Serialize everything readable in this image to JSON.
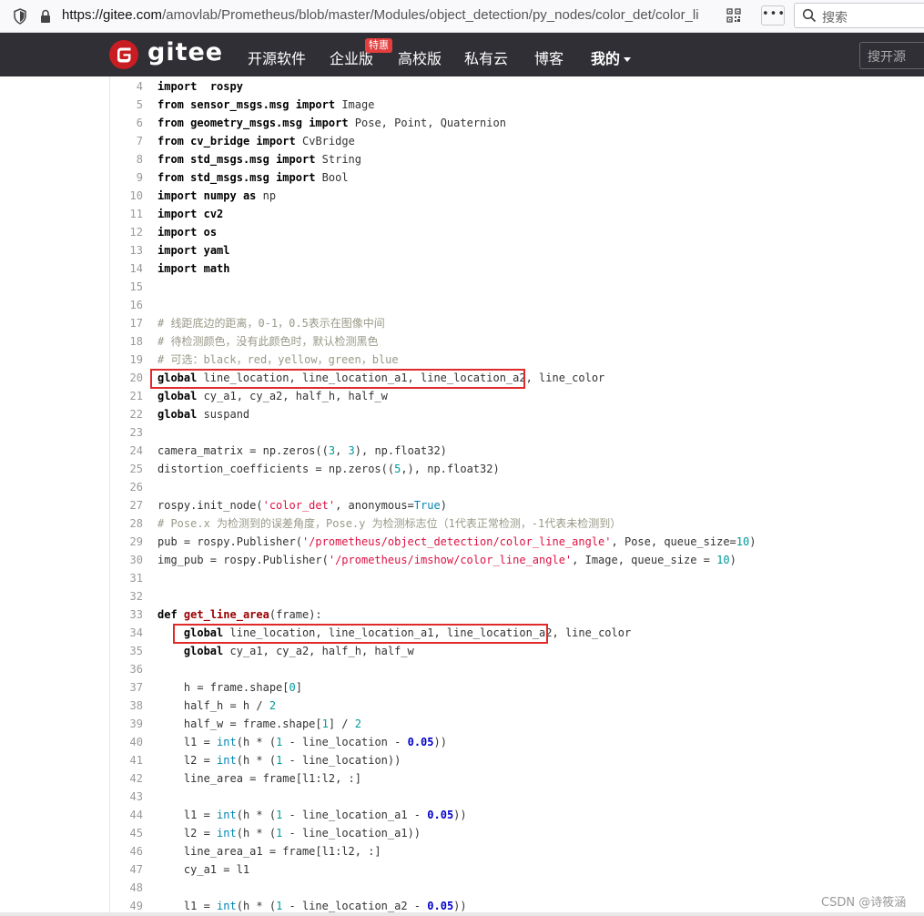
{
  "browser": {
    "url_host": "https://gitee.com",
    "url_path": "/amovlab/Prometheus/blob/master/Modules/object_detection/py_nodes/color_det/color_li",
    "more_label": "•••",
    "search_placeholder": "搜索"
  },
  "nav": {
    "brand": "gitee",
    "items": [
      "开源软件",
      "企业版",
      "高校版",
      "私有云",
      "博客",
      "我的"
    ],
    "badge": "特惠",
    "search_placeholder": "搜开源"
  },
  "code": {
    "lines": [
      {
        "n": "4",
        "tokens": [
          [
            "kw",
            "import"
          ],
          [
            "",
            "  "
          ],
          [
            "mod",
            "rospy"
          ]
        ]
      },
      {
        "n": "5",
        "tokens": [
          [
            "kw",
            "from"
          ],
          [
            "",
            " "
          ],
          [
            "mod",
            "sensor_msgs.msg"
          ],
          [
            "",
            " "
          ],
          [
            "kw",
            "import"
          ],
          [
            "",
            " Image"
          ]
        ]
      },
      {
        "n": "6",
        "tokens": [
          [
            "kw",
            "from"
          ],
          [
            "",
            " "
          ],
          [
            "mod",
            "geometry_msgs.msg"
          ],
          [
            "",
            " "
          ],
          [
            "kw",
            "import"
          ],
          [
            "",
            " Pose, Point, Quaternion"
          ]
        ]
      },
      {
        "n": "7",
        "tokens": [
          [
            "kw",
            "from"
          ],
          [
            "",
            " "
          ],
          [
            "mod",
            "cv_bridge"
          ],
          [
            "",
            " "
          ],
          [
            "kw",
            "import"
          ],
          [
            "",
            " CvBridge"
          ]
        ]
      },
      {
        "n": "8",
        "tokens": [
          [
            "kw",
            "from"
          ],
          [
            "",
            " "
          ],
          [
            "mod",
            "std_msgs.msg"
          ],
          [
            "",
            " "
          ],
          [
            "kw",
            "import"
          ],
          [
            "",
            " String"
          ]
        ]
      },
      {
        "n": "9",
        "tokens": [
          [
            "kw",
            "from"
          ],
          [
            "",
            " "
          ],
          [
            "mod",
            "std_msgs.msg"
          ],
          [
            "",
            " "
          ],
          [
            "kw",
            "import"
          ],
          [
            "",
            " Bool"
          ]
        ]
      },
      {
        "n": "10",
        "tokens": [
          [
            "kw",
            "import"
          ],
          [
            "",
            " "
          ],
          [
            "mod",
            "numpy"
          ],
          [
            "",
            " "
          ],
          [
            "kw",
            "as"
          ],
          [
            "",
            " np"
          ]
        ]
      },
      {
        "n": "11",
        "tokens": [
          [
            "kw",
            "import"
          ],
          [
            "",
            " "
          ],
          [
            "mod",
            "cv2"
          ]
        ]
      },
      {
        "n": "12",
        "tokens": [
          [
            "kw",
            "import"
          ],
          [
            "",
            " "
          ],
          [
            "mod",
            "os"
          ]
        ]
      },
      {
        "n": "13",
        "tokens": [
          [
            "kw",
            "import"
          ],
          [
            "",
            " "
          ],
          [
            "mod",
            "yaml"
          ]
        ]
      },
      {
        "n": "14",
        "tokens": [
          [
            "kw",
            "import"
          ],
          [
            "",
            " "
          ],
          [
            "mod",
            "math"
          ]
        ]
      },
      {
        "n": "15",
        "tokens": []
      },
      {
        "n": "16",
        "tokens": []
      },
      {
        "n": "17",
        "tokens": [
          [
            "cm",
            "# 线距底边的距离，0-1，0.5表示在图像中间"
          ]
        ]
      },
      {
        "n": "18",
        "tokens": [
          [
            "cm",
            "# 待检测颜色，没有此颜色时，默认检测黑色"
          ]
        ]
      },
      {
        "n": "19",
        "tokens": [
          [
            "cm",
            "# 可选：black，red，yellow，green，blue"
          ]
        ]
      },
      {
        "n": "20",
        "tokens": [
          [
            "kw",
            "global"
          ],
          [
            "",
            " line_location, line_location_a1, line_location_a2, line_color"
          ]
        ]
      },
      {
        "n": "21",
        "tokens": [
          [
            "kw",
            "global"
          ],
          [
            "",
            " cy_a1, cy_a2, half_h, half_w"
          ]
        ]
      },
      {
        "n": "22",
        "tokens": [
          [
            "kw",
            "global"
          ],
          [
            "",
            " suspand"
          ]
        ]
      },
      {
        "n": "23",
        "tokens": []
      },
      {
        "n": "24",
        "tokens": [
          [
            "",
            "camera_matrix = np.zeros(("
          ],
          [
            "num",
            "3"
          ],
          [
            "",
            ", "
          ],
          [
            "num",
            "3"
          ],
          [
            "",
            "), np.float32)"
          ]
        ]
      },
      {
        "n": "25",
        "tokens": [
          [
            "",
            "distortion_coefficients = np.zeros(("
          ],
          [
            "num",
            "5"
          ],
          [
            "",
            ",), np.float32)"
          ]
        ]
      },
      {
        "n": "26",
        "tokens": []
      },
      {
        "n": "27",
        "tokens": [
          [
            "",
            "rospy.init_node("
          ],
          [
            "str",
            "'color_det'"
          ],
          [
            "",
            ", anonymous="
          ],
          [
            "bi",
            "True"
          ],
          [
            "",
            ")"
          ]
        ]
      },
      {
        "n": "28",
        "tokens": [
          [
            "cm",
            "# Pose.x 为检测到的误差角度，Pose.y 为检测标志位（1代表正常检测，-1代表未检测到）"
          ]
        ]
      },
      {
        "n": "29",
        "tokens": [
          [
            "",
            "pub = rospy.Publisher("
          ],
          [
            "str",
            "'/prometheus/object_detection/color_line_angle'"
          ],
          [
            "",
            ", Pose, queue_size="
          ],
          [
            "num",
            "10"
          ],
          [
            "",
            ")"
          ]
        ]
      },
      {
        "n": "30",
        "tokens": [
          [
            "",
            "img_pub = rospy.Publisher("
          ],
          [
            "str",
            "'/prometheus/imshow/color_line_angle'"
          ],
          [
            "",
            ", Image, queue_size = "
          ],
          [
            "num",
            "10"
          ],
          [
            "",
            ")"
          ]
        ]
      },
      {
        "n": "31",
        "tokens": []
      },
      {
        "n": "32",
        "tokens": []
      },
      {
        "n": "33",
        "tokens": [
          [
            "kw",
            "def"
          ],
          [
            "",
            " "
          ],
          [
            "fn",
            "get_line_area"
          ],
          [
            "",
            "(frame):"
          ]
        ]
      },
      {
        "n": "34",
        "tokens": [
          [
            "",
            "    "
          ],
          [
            "kw",
            "global"
          ],
          [
            "",
            " line_location, line_location_a1, line_location_a2, line_color"
          ]
        ]
      },
      {
        "n": "35",
        "tokens": [
          [
            "",
            "    "
          ],
          [
            "kw",
            "global"
          ],
          [
            "",
            " cy_a1, cy_a2, half_h, half_w"
          ]
        ]
      },
      {
        "n": "36",
        "tokens": []
      },
      {
        "n": "37",
        "tokens": [
          [
            "",
            "    h = frame.shape["
          ],
          [
            "num",
            "0"
          ],
          [
            "",
            "]"
          ]
        ]
      },
      {
        "n": "38",
        "tokens": [
          [
            "",
            "    half_h = h / "
          ],
          [
            "num",
            "2"
          ]
        ]
      },
      {
        "n": "39",
        "tokens": [
          [
            "",
            "    half_w = frame.shape["
          ],
          [
            "num",
            "1"
          ],
          [
            "",
            "] / "
          ],
          [
            "num",
            "2"
          ]
        ]
      },
      {
        "n": "40",
        "tokens": [
          [
            "",
            "    l1 = "
          ],
          [
            "bi",
            "int"
          ],
          [
            "",
            "(h * ("
          ],
          [
            "num",
            "1"
          ],
          [
            "",
            " - line_location - "
          ],
          [
            "bnum",
            "0.05"
          ],
          [
            "",
            "))"
          ]
        ]
      },
      {
        "n": "41",
        "tokens": [
          [
            "",
            "    l2 = "
          ],
          [
            "bi",
            "int"
          ],
          [
            "",
            "(h * ("
          ],
          [
            "num",
            "1"
          ],
          [
            "",
            " - line_location))"
          ]
        ]
      },
      {
        "n": "42",
        "tokens": [
          [
            "",
            "    line_area = frame[l1:l2, :]"
          ]
        ]
      },
      {
        "n": "43",
        "tokens": []
      },
      {
        "n": "44",
        "tokens": [
          [
            "",
            "    l1 = "
          ],
          [
            "bi",
            "int"
          ],
          [
            "",
            "(h * ("
          ],
          [
            "num",
            "1"
          ],
          [
            "",
            " - line_location_a1 - "
          ],
          [
            "bnum",
            "0.05"
          ],
          [
            "",
            "))"
          ]
        ]
      },
      {
        "n": "45",
        "tokens": [
          [
            "",
            "    l2 = "
          ],
          [
            "bi",
            "int"
          ],
          [
            "",
            "(h * ("
          ],
          [
            "num",
            "1"
          ],
          [
            "",
            " - line_location_a1))"
          ]
        ]
      },
      {
        "n": "46",
        "tokens": [
          [
            "",
            "    line_area_a1 = frame[l1:l2, :]"
          ]
        ]
      },
      {
        "n": "47",
        "tokens": [
          [
            "",
            "    cy_a1 = l1"
          ]
        ]
      },
      {
        "n": "48",
        "tokens": []
      },
      {
        "n": "49",
        "tokens": [
          [
            "",
            "    l1 = "
          ],
          [
            "bi",
            "int"
          ],
          [
            "",
            "(h * ("
          ],
          [
            "num",
            "1"
          ],
          [
            "",
            " - line_location_a2 - "
          ],
          [
            "bnum",
            "0.05"
          ],
          [
            "",
            "))"
          ]
        ]
      }
    ]
  },
  "watermark": "CSDN @诗筱涵",
  "colors": {
    "nav_bg": "#2f2f35",
    "highlight": "#e02a2a",
    "brand_red": "#c71d23"
  }
}
